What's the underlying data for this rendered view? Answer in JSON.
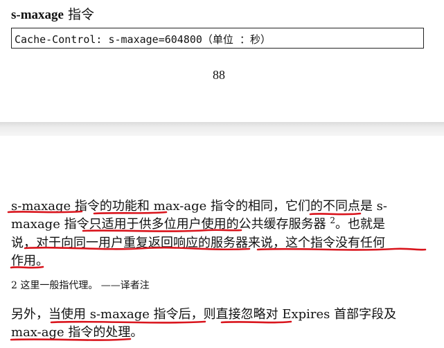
{
  "page_top": {
    "heading_term": "s-maxage",
    "heading_suffix": " 指令",
    "code": "Cache-Control: s-maxage=604800（单位 ：秒）",
    "page_number": "88"
  },
  "page_bottom": {
    "paragraph1_lines": [
      "s-maxage 指令的功能和 max-age 指令的相同，它们的不同点是 s-",
      "maxage 指令只适用于供多位用户使用的公共缓存服务器",
      "说，对于向同一用户重复返回响应的服务器来说，这个指令没有任何",
      "作用。"
    ],
    "footnote_ref": "2",
    "paragraph1_line2_tail": "。也就是",
    "footnote": "2 这里一般指代理。 ——译者注",
    "paragraph2_lines": [
      "另外，当使用 s-maxage 指令后，则直接忽略对 Expires 首部字段及",
      "max-age 指令的处理。"
    ]
  },
  "annotation": {
    "color": "#d9141c"
  }
}
